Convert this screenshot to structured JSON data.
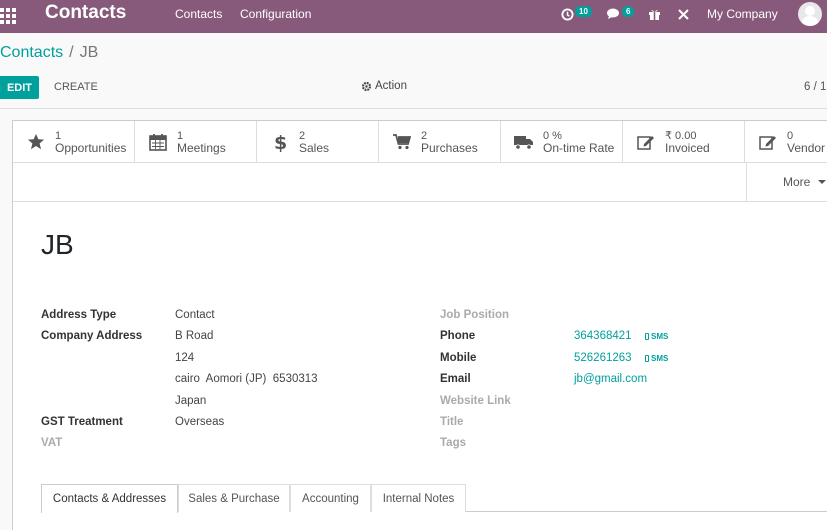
{
  "navbar": {
    "app_title": "Contacts",
    "menu": [
      "Contacts",
      "Configuration"
    ],
    "activity_count": "10",
    "message_count": "6",
    "company": "My Company"
  },
  "breadcrumb": {
    "parent": "Contacts",
    "separator": "/",
    "current": "JB"
  },
  "toolbar": {
    "edit_label": "EDIT",
    "create_label": "CREATE",
    "action_label": "Action",
    "pager": "6 / 1"
  },
  "smart_buttons": [
    {
      "value": "1",
      "label": "Opportunities",
      "icon": "star-icon"
    },
    {
      "value": "1",
      "label": "Meetings",
      "icon": "calendar-icon"
    },
    {
      "value": "2",
      "label": "Sales",
      "icon": "dollar-icon"
    },
    {
      "value": "2",
      "label": "Purchases",
      "icon": "cart-icon"
    },
    {
      "value": "0 %",
      "label": "On-time Rate",
      "icon": "truck-icon"
    },
    {
      "value": "₹ 0.00",
      "label": "Invoiced",
      "icon": "edit-icon"
    },
    {
      "value": "0",
      "label": "Vendor",
      "icon": "edit-icon"
    }
  ],
  "more_label": "More",
  "record": {
    "name": "JB"
  },
  "left_fields": {
    "address_type_label": "Address Type",
    "address_type_value": "Contact",
    "company_address_label": "Company Address",
    "street": "B Road",
    "street2": "124",
    "city_line": "cairo  Aomori (JP)  6530313",
    "country": "Japan",
    "gst_label": "GST Treatment",
    "gst_value": "Overseas",
    "vat_label": "VAT"
  },
  "right_fields": {
    "job_position_label": "Job Position",
    "phone_label": "Phone",
    "phone_value": "364368421",
    "mobile_label": "Mobile",
    "mobile_value": "526261263",
    "sms_label": "SMS",
    "email_label": "Email",
    "email_value": "jb@gmail.com",
    "website_label": "Website Link",
    "title_label": "Title",
    "tags_label": "Tags"
  },
  "tabs": [
    "Contacts & Addresses",
    "Sales & Purchase",
    "Accounting",
    "Internal Notes"
  ],
  "colors": {
    "navbar": "#875a7b",
    "accent": "#00a09d"
  }
}
